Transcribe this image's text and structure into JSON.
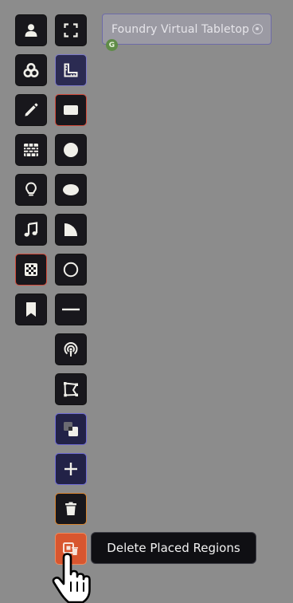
{
  "world": {
    "title": "Foundry Virtual Tabletop",
    "gm_badge": "G"
  },
  "tooltip": {
    "text": "Delete Placed Regions"
  },
  "scene_controls": [
    {
      "name": "tokens",
      "icon": "user-icon"
    },
    {
      "name": "templates",
      "icon": "shapes-icon"
    },
    {
      "name": "drawings",
      "icon": "pencil-icon"
    },
    {
      "name": "walls",
      "icon": "brick-wall-icon"
    },
    {
      "name": "lighting",
      "icon": "lightbulb-icon"
    },
    {
      "name": "sounds",
      "icon": "music-icon"
    },
    {
      "name": "regions",
      "icon": "regions-checker-icon",
      "active": true
    },
    {
      "name": "notes",
      "icon": "bookmark-icon"
    }
  ],
  "region_tools": [
    {
      "name": "select",
      "icon": "expand-corners-icon"
    },
    {
      "name": "snap-to-grid",
      "icon": "ruler-square-icon",
      "toggled": true
    },
    {
      "name": "rectangle",
      "icon": "rectangle-icon",
      "active": true
    },
    {
      "name": "circle",
      "icon": "circle-filled-icon"
    },
    {
      "name": "ellipse",
      "icon": "ellipse-icon"
    },
    {
      "name": "cone",
      "icon": "cone-icon"
    },
    {
      "name": "ring",
      "icon": "circle-outline-icon"
    },
    {
      "name": "line",
      "icon": "line-icon"
    },
    {
      "name": "emanation",
      "icon": "emanation-icon"
    },
    {
      "name": "polygon",
      "icon": "polygon-icon"
    },
    {
      "name": "hole",
      "icon": "overlap-squares-icon",
      "toggled": true
    },
    {
      "name": "add",
      "icon": "plus-icon",
      "toggled": true
    },
    {
      "name": "delete",
      "icon": "trash-icon",
      "outlined": true
    },
    {
      "name": "delete-placed-regions",
      "icon": "delete-regions-icon",
      "hot": true
    }
  ],
  "colors": {
    "canvas": "#8c8c8c",
    "tool_bg": "#18171c",
    "active_border": "#d24a3a",
    "toggle_border": "#7d7ac8",
    "hot_bg": "#d8562f"
  }
}
